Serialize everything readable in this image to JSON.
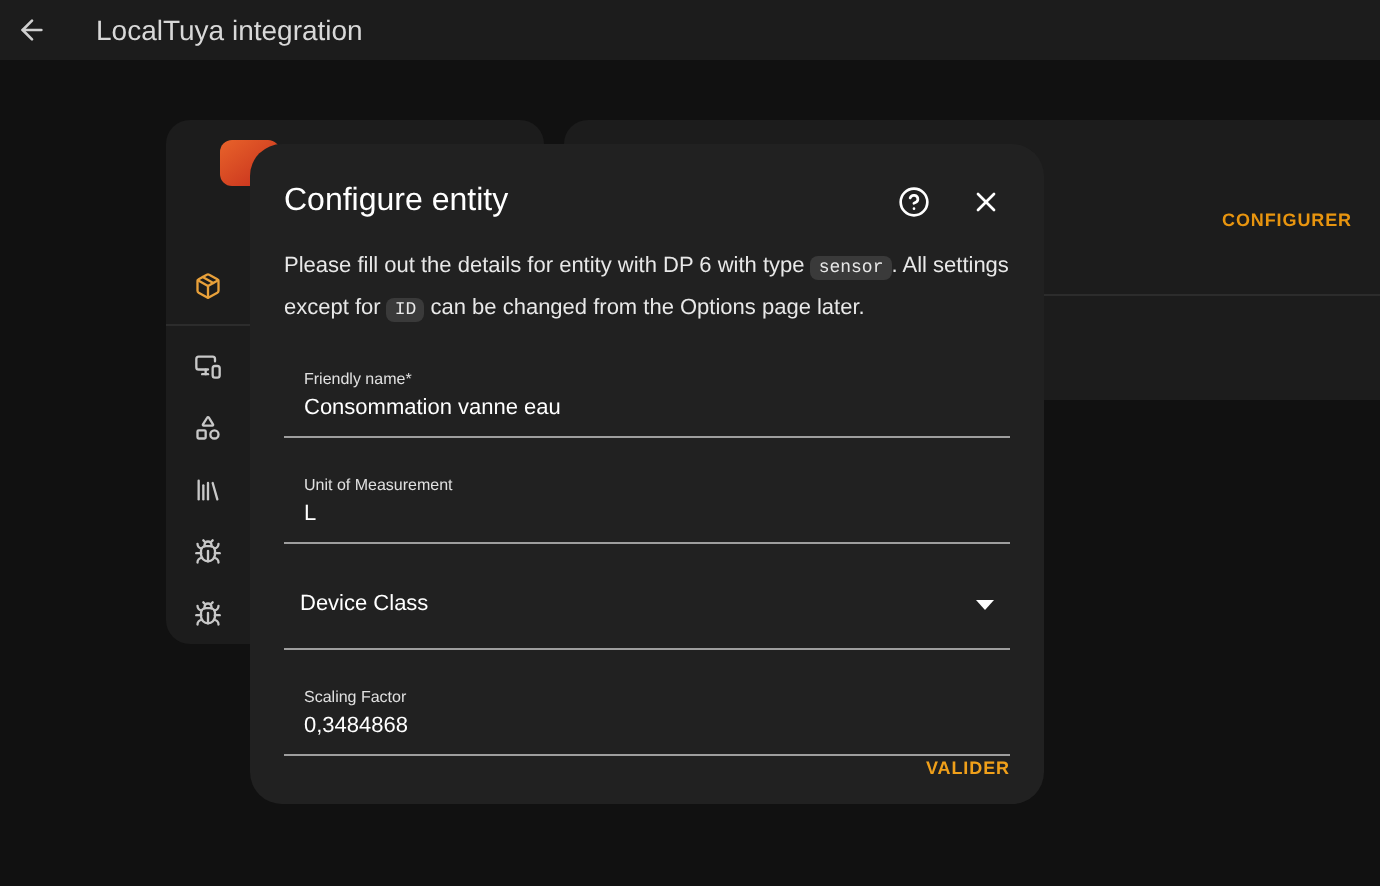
{
  "header": {
    "title": "LocalTuya integration"
  },
  "sidebar": {
    "icons": [
      {
        "kind": "integration"
      },
      {
        "kind": "devices"
      },
      {
        "kind": "entities"
      },
      {
        "kind": "documentation"
      },
      {
        "kind": "issues"
      },
      {
        "kind": "debug"
      }
    ]
  },
  "integration_card": {
    "action": "CONFIGURER"
  },
  "dialog": {
    "title": "Configure entity",
    "description": [
      {
        "kind": "text",
        "text": "Please fill out the details for entity with DP 6 with type"
      },
      {
        "kind": "code",
        "text": "sensor"
      },
      {
        "kind": "text",
        "text": ". All settings except for"
      },
      {
        "kind": "code",
        "text": "ID"
      },
      {
        "kind": "text",
        "text": "can be changed from the Options page later."
      }
    ],
    "fields": [
      {
        "kind": "text",
        "label": "Friendly name*",
        "value": "Consommation vanne eau"
      },
      {
        "kind": "text",
        "label": "Unit of Measurement",
        "value": "L"
      },
      {
        "kind": "select",
        "label": "Device Class"
      },
      {
        "kind": "text",
        "label": "Scaling Factor",
        "value": "0,3484868"
      }
    ],
    "submit": "VALIDER"
  }
}
